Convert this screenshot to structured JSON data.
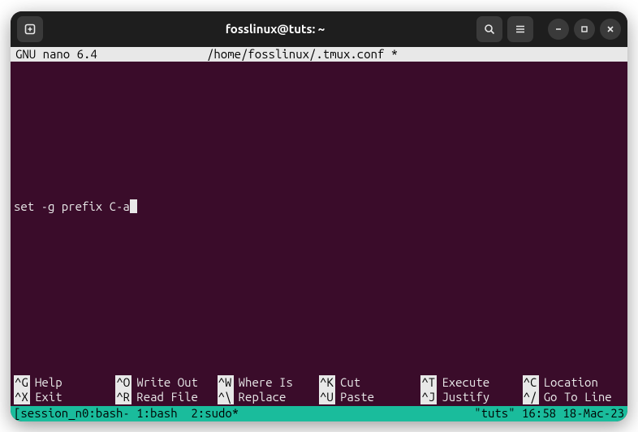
{
  "titlebar": {
    "title": "fosslinux@tuts: ~"
  },
  "nano": {
    "app": "GNU nano 6.4",
    "file": "/home/fosslinux/.tmux.conf *",
    "content": "set -g prefix C-a",
    "help": {
      "row1": [
        {
          "key": "^G",
          "label": "Help"
        },
        {
          "key": "^O",
          "label": "Write Out"
        },
        {
          "key": "^W",
          "label": "Where Is"
        },
        {
          "key": "^K",
          "label": "Cut"
        },
        {
          "key": "^T",
          "label": "Execute"
        },
        {
          "key": "^C",
          "label": "Location"
        }
      ],
      "row2": [
        {
          "key": "^X",
          "label": "Exit"
        },
        {
          "key": "^R",
          "label": "Read File"
        },
        {
          "key": "^\\",
          "label": "Replace"
        },
        {
          "key": "^U",
          "label": "Paste"
        },
        {
          "key": "^J",
          "label": "Justify"
        },
        {
          "key": "^/",
          "label": "Go To Line"
        }
      ]
    }
  },
  "tmux": {
    "left": "[session_n0:bash- 1:bash  2:sudo*",
    "right": "\"tuts\" 16:58 18-Mac-23"
  }
}
